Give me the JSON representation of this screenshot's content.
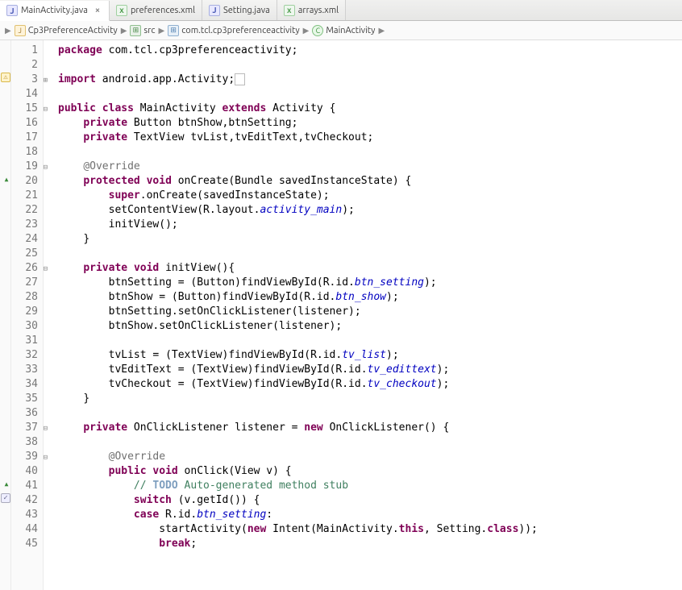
{
  "tabs": [
    {
      "label": "MainActivity.java",
      "type": "java",
      "active": true,
      "closeable": true
    },
    {
      "label": "preferences.xml",
      "type": "xml",
      "active": false,
      "closeable": false
    },
    {
      "label": "Setting.java",
      "type": "java",
      "active": false,
      "closeable": false
    },
    {
      "label": "arrays.xml",
      "type": "xml",
      "active": false,
      "closeable": false
    }
  ],
  "breadcrumb": {
    "items": [
      {
        "icon": "proj",
        "label": "Cp3PreferenceActivity"
      },
      {
        "icon": "src",
        "label": "src"
      },
      {
        "icon": "pkg",
        "label": "com.tcl.cp3preferenceactivity"
      },
      {
        "icon": "cls",
        "label": "MainActivity"
      }
    ]
  },
  "lineNumbers": [
    "1",
    "2",
    "3",
    "14",
    "15",
    "16",
    "17",
    "18",
    "19",
    "20",
    "21",
    "22",
    "23",
    "24",
    "25",
    "26",
    "27",
    "28",
    "29",
    "30",
    "31",
    "32",
    "33",
    "34",
    "35",
    "36",
    "37",
    "38",
    "39",
    "40",
    "41",
    "42",
    "43",
    "44",
    "45"
  ],
  "code": {
    "pkg": "package",
    "pkgName": " com.tcl.cp3preferenceactivity;",
    "imp": "import",
    "impName": " android.app.Activity;",
    "public": "public",
    "classKw": "class",
    "className": " MainActivity ",
    "extends": "extends",
    "activity": " Activity {",
    "private": "private",
    "button": " Button btnShow,btnSetting;",
    "textview": " TextView tvList,tvEditText,tvCheckout;",
    "override": "@Override",
    "protected": "protected",
    "void": "void",
    "onCreate": " onCreate(Bundle savedInstanceState) {",
    "super": "super",
    "superCall": ".onCreate(savedInstanceState);",
    "setCV": "setContentView(R.layout.",
    "actMain": "activity_main",
    "closeParen": ");",
    "initViewCall": "initView();",
    "braceClose": "}",
    "initViewDecl": " initView(){",
    "l27a": "btnSetting = (Button)findViewById(R.id.",
    "l27b": "btn_setting",
    "l28a": "btnShow = (Button)findViewById(R.id.",
    "l28b": "btn_show",
    "l29": "btnSetting.setOnClickListener(listener);",
    "l30": "btnShow.setOnClickListener(listener);",
    "l32a": "tvList = (TextView)findViewById(R.id.",
    "l32b": "tv_list",
    "l33a": "tvEditText = (TextView)findViewById(R.id.",
    "l33b": "tv_edittext",
    "l34a": "tvCheckout = (TextView)findViewById(R.id.",
    "l34b": "tv_checkout",
    "l37a": " OnClickListener listener = ",
    "new": "new",
    "l37b": " OnClickListener() {",
    "l40": " onClick(View v) {",
    "todo": "// ",
    "todoTag": "TODO",
    "todoRest": " Auto-generated method stub",
    "switch": "switch",
    "l42": " (v.getId()) {",
    "case": "case",
    "l43a": " R.id.",
    "l43b": "btn_setting",
    "l43c": ":",
    "l44a": "startActivity(",
    "l44b": " Intent(MainActivity.",
    "this": "this",
    "l44c": ", Setting.",
    "classRef": "class",
    "l44d": "));",
    "break": "break",
    "semi": ";"
  }
}
